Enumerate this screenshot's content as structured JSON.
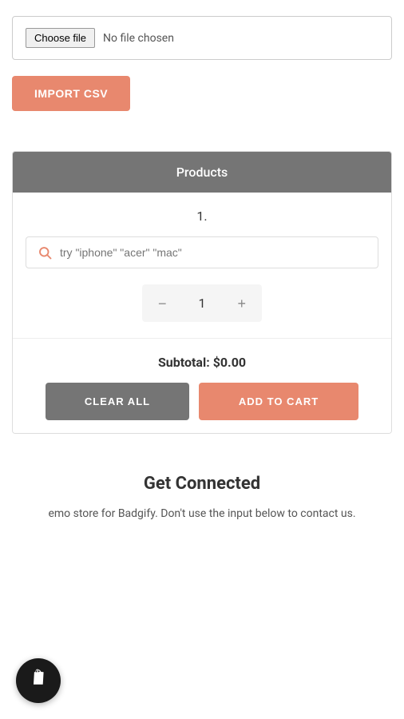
{
  "file_section": {
    "choose_btn_label": "Choose file",
    "no_file_label": "No file chosen",
    "import_btn_label": "IMPORT CSV"
  },
  "products_section": {
    "header_label": "Products",
    "product_number": "1.",
    "search_placeholder": "try \"iphone\" \"acer\" \"mac\"",
    "quantity": "1",
    "qty_minus": "−",
    "qty_plus": "+",
    "subtotal_label": "Subtotal:",
    "subtotal_value": "$0.00",
    "clear_all_label": "CLEAR ALL",
    "add_to_cart_label": "ADD TO CART"
  },
  "get_connected": {
    "title": "Get Connected",
    "description": "emo store for Badgify. Don't use the input below to contact us."
  },
  "shopify": {
    "icon_label": "S"
  }
}
